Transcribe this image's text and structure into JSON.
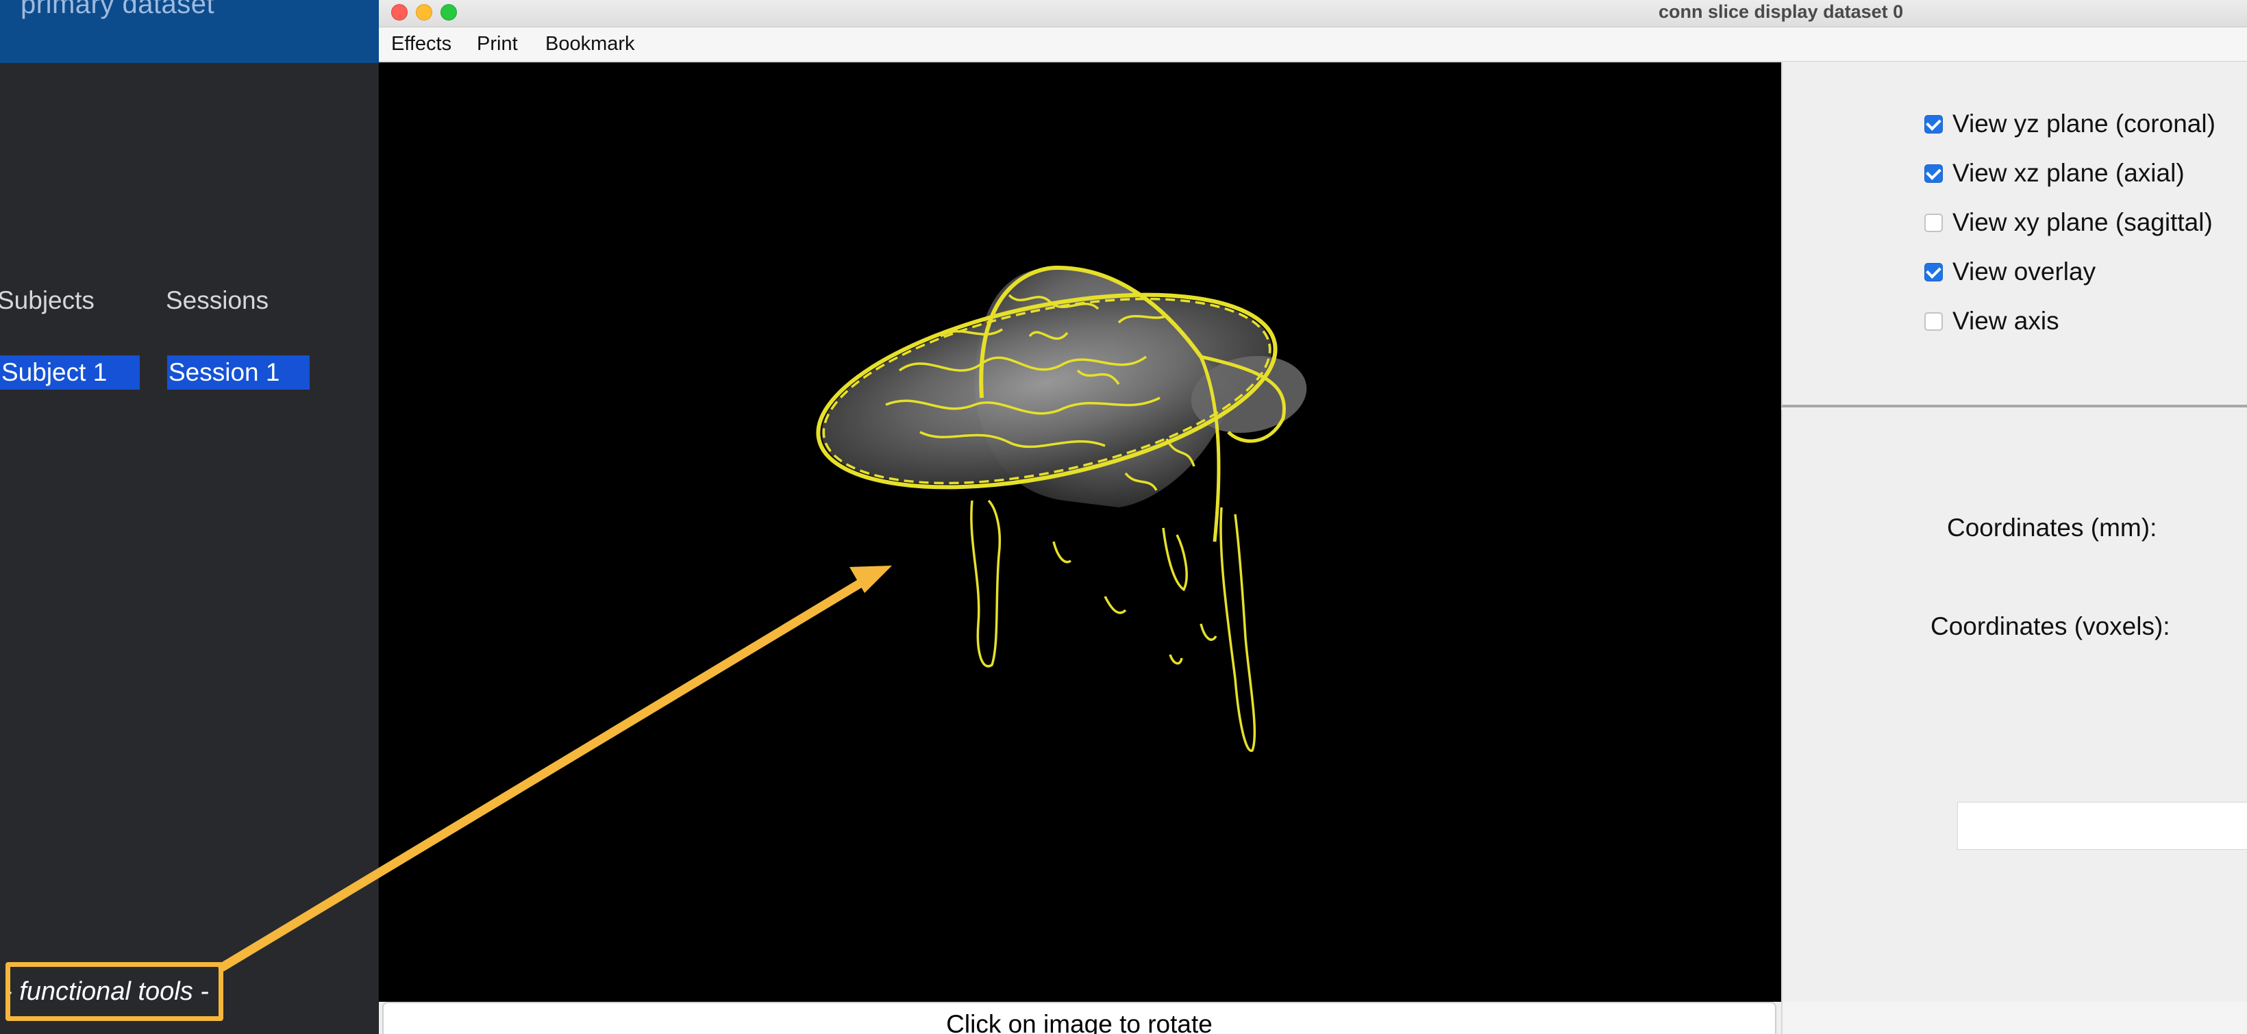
{
  "conn": {
    "header_title": "primary dataset",
    "subjects_label": "Subjects",
    "sessions_label": "Sessions",
    "selected_subject": "Subject 1",
    "selected_session": "Session 1",
    "tools_label": "- functional tools -"
  },
  "window": {
    "title": "conn slice display dataset 0",
    "menus": [
      "Effects",
      "Print",
      "Bookmark"
    ],
    "rotate_hint": "Click on image to rotate"
  },
  "options": [
    {
      "label": "View yz plane (coronal)",
      "checked": true
    },
    {
      "label": "View xz plane (axial)",
      "checked": true
    },
    {
      "label": "View xy plane (sagittal)",
      "checked": false
    },
    {
      "label": "View overlay",
      "checked": true
    },
    {
      "label": "View axis",
      "checked": false
    }
  ],
  "coords": {
    "mm_label": "Coordinates (mm):",
    "voxels_label": "Coordinates (voxels):",
    "value": ""
  },
  "colors": {
    "overlay_contour": "#e6e02a",
    "annotation": "#f5b83d",
    "selection": "#1552d6",
    "checkbox_on": "#1f73e6"
  },
  "icons": [
    "close-icon",
    "minimize-icon",
    "maximize-icon",
    "checkbox-icon",
    "arrow-annotation"
  ]
}
